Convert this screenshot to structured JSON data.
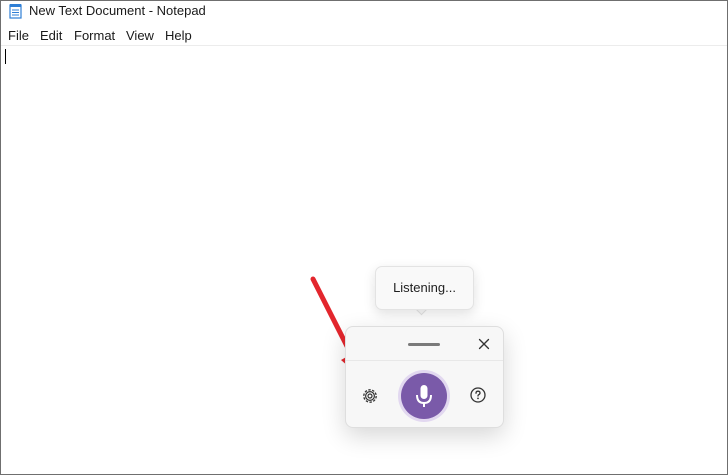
{
  "window": {
    "title": "New Text Document - Notepad",
    "icon": "notepad-icon"
  },
  "menu": {
    "items": [
      "File",
      "Edit",
      "Format",
      "View",
      "Help"
    ]
  },
  "editor": {
    "text": ""
  },
  "voice_typing": {
    "tooltip": "Listening...",
    "icons": {
      "drag": "drag-handle-icon",
      "close": "close-icon",
      "settings": "gear-icon",
      "microphone": "microphone-icon",
      "help": "help-icon"
    },
    "mic_color": "#7a5aa9"
  },
  "annotation": {
    "arrow_color": "#e3262d",
    "icon": "arrow-icon"
  }
}
